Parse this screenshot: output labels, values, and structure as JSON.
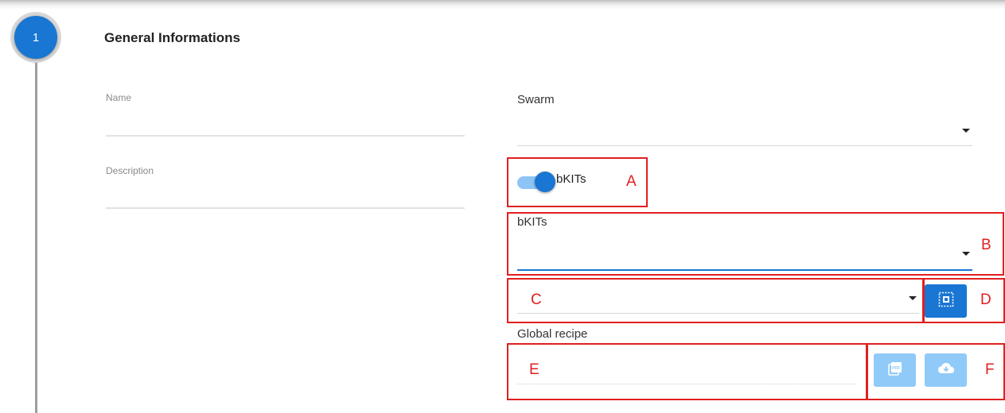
{
  "step": {
    "number": "1"
  },
  "section": {
    "title": "General Informations"
  },
  "form": {
    "name_label": "Name",
    "description_label": "Description",
    "swarm_label": "Swarm",
    "bkits_toggle_label": "bKITs",
    "bkits_toggle_on": true,
    "bkits_select_label": "bKITs",
    "global_recipe_label": "Global recipe"
  },
  "annotations": {
    "a": "A",
    "b": "B",
    "c": "C",
    "d": "D",
    "e": "E",
    "f": "F"
  },
  "icons": {
    "scan": "scan-icon",
    "pdf": "pdf-icon",
    "download": "cloud-download-icon"
  },
  "colors": {
    "primary": "#1976d2",
    "primary_light": "#90caf9",
    "annotation_red": "#e02020"
  }
}
